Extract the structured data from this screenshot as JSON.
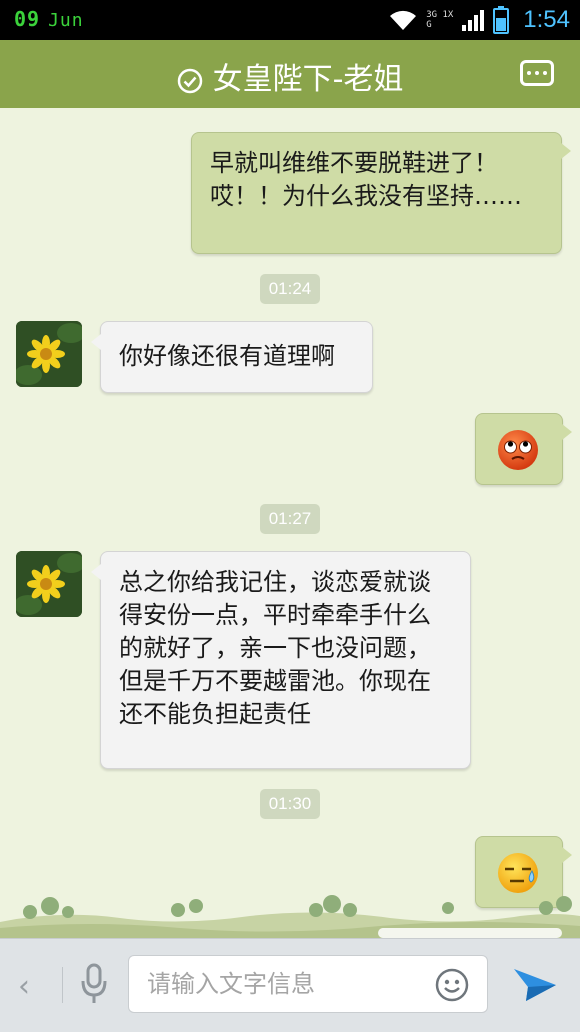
{
  "status_bar": {
    "date_day": "09",
    "date_month": "Jun",
    "network_top": "3G 1X",
    "network_bottom": "G",
    "time": "1:54"
  },
  "header": {
    "title": "女皇陛下-老姐"
  },
  "messages": [
    {
      "type": "text",
      "direction": "out",
      "text": "早就叫维维不要脱鞋进了！哎！！为什么我没有坚持……"
    },
    {
      "type": "timestamp",
      "text": "01:24"
    },
    {
      "type": "text",
      "direction": "in",
      "text": "你好像还很有道理啊"
    },
    {
      "type": "emoji",
      "direction": "out",
      "emoji": "rolling-eyes-emoji-icon"
    },
    {
      "type": "timestamp",
      "text": "01:27"
    },
    {
      "type": "text",
      "direction": "in",
      "text": "总之你给我记住，谈恋爱就谈得安份一点，平时牵牵手什么的就好了，亲一下也没问题，但是千万不要越雷池。你现在还不能负担起责任"
    },
    {
      "type": "timestamp",
      "text": "01:30"
    },
    {
      "type": "emoji",
      "direction": "out",
      "emoji": "sweat-emoji-icon"
    }
  ],
  "input_bar": {
    "placeholder": "请输入文字信息"
  },
  "colors": {
    "header": "#8aa44b",
    "outgoing_bubble": "#cfdca6",
    "incoming_bubble": "#f3f3f3",
    "chat_background": "#eef3df",
    "status_time": "#4fc3ff",
    "status_date": "#3bd23b"
  }
}
